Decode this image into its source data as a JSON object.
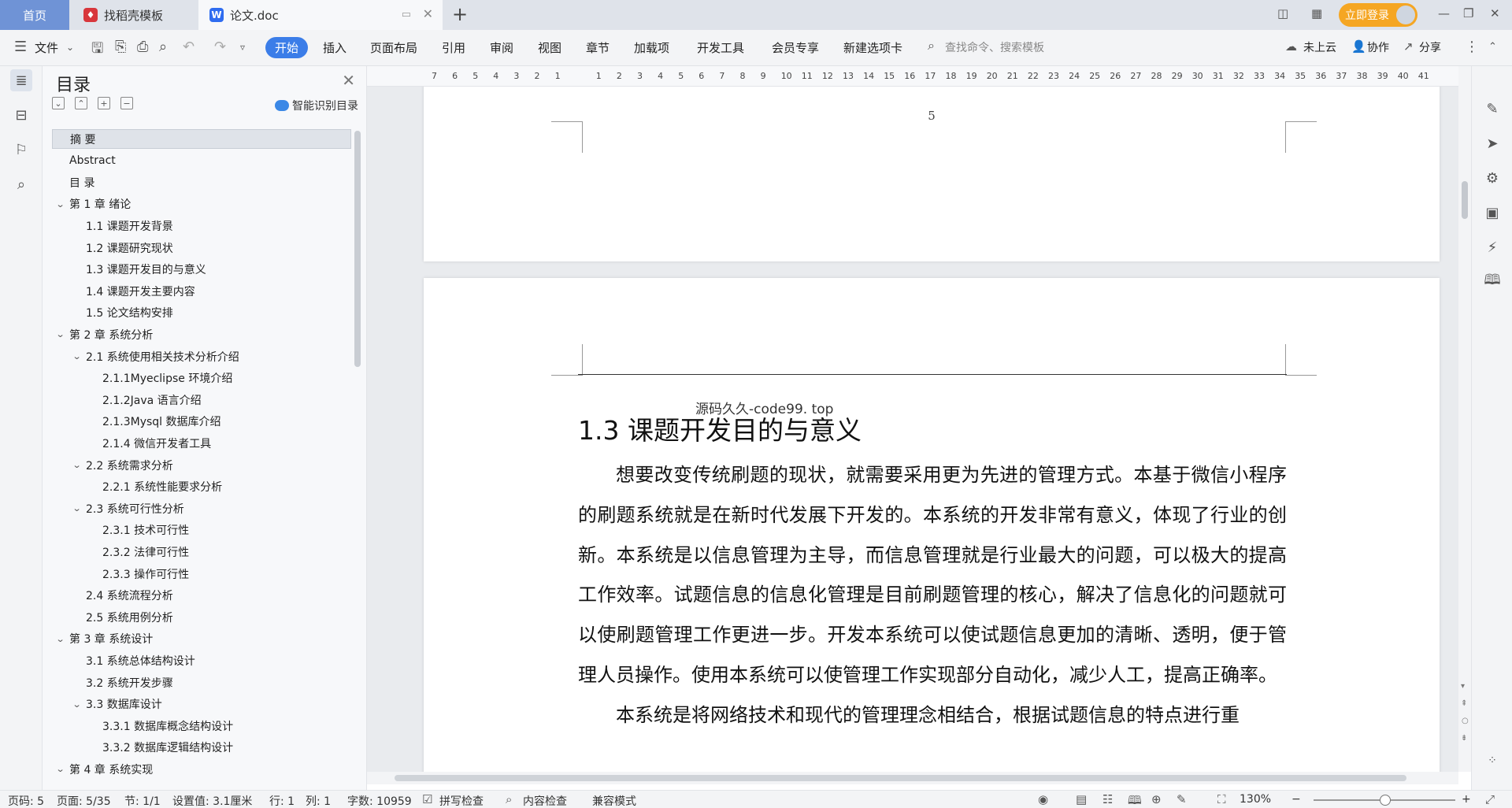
{
  "tabs": [
    {
      "label": "首页"
    },
    {
      "label": "找稻壳模板"
    },
    {
      "label": "论文.doc"
    }
  ],
  "titlebar": {
    "login_label": "立即登录"
  },
  "ribbon": {
    "file_label": "文件",
    "menus": [
      "开始",
      "插入",
      "页面布局",
      "引用",
      "审阅",
      "视图",
      "章节",
      "加载项",
      "开发工具",
      "会员专享",
      "新建选项卡"
    ],
    "search_placeholder": "查找命令、搜索模板",
    "cloud_label": "未上云",
    "collab_label": "协作",
    "share_label": "分享"
  },
  "toc": {
    "title": "目录",
    "smart_label": "智能识别目录",
    "items": [
      {
        "label": "摘  要",
        "level": 1,
        "selected": true
      },
      {
        "label": "Abstract",
        "level": 1
      },
      {
        "label": "目  录",
        "level": 1
      },
      {
        "label": "第 1 章   绪论",
        "level": 1,
        "expanded": true
      },
      {
        "label": "1.1 课题开发背景",
        "level": 2
      },
      {
        "label": "1.2 课题研究现状",
        "level": 2
      },
      {
        "label": "1.3 课题开发目的与意义",
        "level": 2
      },
      {
        "label": "1.4 课题开发主要内容",
        "level": 2
      },
      {
        "label": "1.5 论文结构安排",
        "level": 2
      },
      {
        "label": "第 2 章  系统分析",
        "level": 1,
        "expanded": true
      },
      {
        "label": "2.1 系统使用相关技术分析介绍",
        "level": 2,
        "expanded": true
      },
      {
        "label": "2.1.1Myeclipse 环境介绍",
        "level": 3
      },
      {
        "label": "2.1.2Java 语言介绍",
        "level": 3
      },
      {
        "label": " 2.1.3Mysql 数据库介绍",
        "level": 3
      },
      {
        "label": "2.1.4 微信开发者工具",
        "level": 3
      },
      {
        "label": "2.2 系统需求分析",
        "level": 2,
        "expanded": true
      },
      {
        "label": "2.2.1 系统性能要求分析",
        "level": 3
      },
      {
        "label": "2.3 系统可行性分析",
        "level": 2,
        "expanded": true
      },
      {
        "label": "2.3.1 技术可行性",
        "level": 3
      },
      {
        "label": "2.3.2 法律可行性",
        "level": 3
      },
      {
        "label": "2.3.3 操作可行性",
        "level": 3
      },
      {
        "label": "2.4 系统流程分析",
        "level": 2
      },
      {
        "label": "2.5 系统用例分析",
        "level": 2
      },
      {
        "label": "第 3 章  系统设计",
        "level": 1,
        "expanded": true
      },
      {
        "label": "3.1 系统总体结构设计",
        "level": 2
      },
      {
        "label": "3.2 系统开发步骤",
        "level": 2
      },
      {
        "label": "3.3 数据库设计",
        "level": 2,
        "expanded": true
      },
      {
        "label": "3.3.1 数据库概念结构设计",
        "level": 3
      },
      {
        "label": "3.3.2 数据库逻辑结构设计",
        "level": 3
      },
      {
        "label": "第 4 章  系统实现",
        "level": 1,
        "expanded": true
      }
    ]
  },
  "ruler": {
    "labels": [
      "7",
      "6",
      "5",
      "4",
      "3",
      "2",
      "1",
      "",
      "1",
      "2",
      "3",
      "4",
      "5",
      "6",
      "7",
      "8",
      "9",
      "10",
      "11",
      "12",
      "13",
      "14",
      "15",
      "16",
      "17",
      "18",
      "19",
      "20",
      "21",
      "22",
      "23",
      "24",
      "25",
      "26",
      "27",
      "28",
      "29",
      "30",
      "31",
      "32",
      "33",
      "34",
      "35",
      "36",
      "37",
      "38",
      "39",
      "40",
      "41"
    ]
  },
  "document": {
    "page_number": "5",
    "watermark": "源码久久-code99. top",
    "heading": "1.3 课题开发目的与意义",
    "paragraphs": [
      "想要改变传统刷题的现状，就需要采用更为先进的管理方式。本基于微信小程序的刷题系统就是在新时代发展下开发的。本系统的开发非常有意义，体现了行业的创新。本系统是以信息管理为主导，而信息管理就是行业最大的问题，可以极大的提高工作效率。试题信息的信息化管理是目前刷题管理的核心，解决了信息化的问题就可以使刷题管理工作更进一步。开发本系统可以使试题信息更加的清晰、透明，便于管理人员操作。使用本系统可以使管理工作实现部分自动化，减少人工，提高正确率。",
      "本系统是将网络技术和现代的管理理念相结合，根据试题信息的特点进行重"
    ]
  },
  "statusbar": {
    "page_code": "页码: 5",
    "pages": "页面: 5/35",
    "section": "节: 1/1",
    "setting": "设置值: 3.1厘米",
    "row": "行: 1",
    "col": "列: 1",
    "word_count": "字数: 10959",
    "spell_check": "拼写检查",
    "content_check": "内容检查",
    "compat_mode": "兼容模式",
    "zoom": "130%"
  },
  "colors": {
    "accent": "#3b7de8",
    "home_tab": "#6f93d6",
    "login": "#f5a623"
  }
}
